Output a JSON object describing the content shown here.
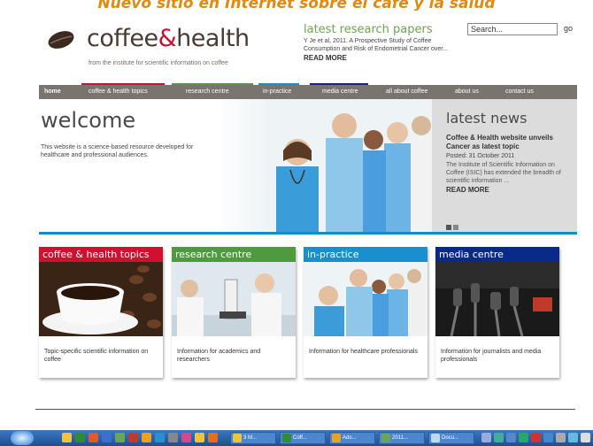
{
  "banner": {
    "title": "Nuevo sitio en Internet sobre el café y la salud"
  },
  "logo": {
    "brand_left": "coffee",
    "brand_amp": "&",
    "brand_right": "health",
    "tagline": "from the institute for scientific information on coffee"
  },
  "research": {
    "heading": "latest research papers",
    "text": "Y Je et al, 2011. A Prospective Study of Coffee Consumption and Risk of Endometrial Cancer over...",
    "more": "READ MORE"
  },
  "search": {
    "placeholder": "Search...",
    "go": "go"
  },
  "nav": {
    "items": [
      {
        "label": "home"
      },
      {
        "label": "coffee & health topics"
      },
      {
        "label": "research centre"
      },
      {
        "label": "in-practice"
      },
      {
        "label": "media centre"
      },
      {
        "label": "all about coffee"
      },
      {
        "label": "about us"
      },
      {
        "label": "contact us"
      }
    ]
  },
  "hero": {
    "welcome": "welcome",
    "description": "This website is a science-based resource developed for healthcare and professional audiences."
  },
  "news": {
    "heading": "latest news",
    "title": "Coffee & Health website unveils Cancer as latest topic",
    "date": "Posted: 31 October 2011",
    "body": "The Institute of Scientific Information on Coffee (ISIC) has extended the breadth of scientific information ...",
    "more": "READ MORE"
  },
  "cards": [
    {
      "title": "coffee & health topics",
      "text": "Topic-specific scientific information on coffee",
      "color": "#d0102e"
    },
    {
      "title": "research centre",
      "text": "Information for academics and researchers",
      "color": "#4e9a3e"
    },
    {
      "title": "in-practice",
      "text": "Information for healthcare professionals",
      "color": "#1a8fd0"
    },
    {
      "title": "media centre",
      "text": "Information for journalists and media professionals",
      "color": "#0a2a8a"
    }
  ],
  "taskbar": {
    "buttons": [
      {
        "label": "3 M..."
      },
      {
        "label": "Coff..."
      },
      {
        "label": "Ado..."
      },
      {
        "label": "2011..."
      },
      {
        "label": "Docu..."
      }
    ]
  },
  "colors": {
    "nav_bg": "#7a746e",
    "accent_blue": "#0a8fd0",
    "brand_red": "#c8102e",
    "research_green": "#6aa84f"
  }
}
